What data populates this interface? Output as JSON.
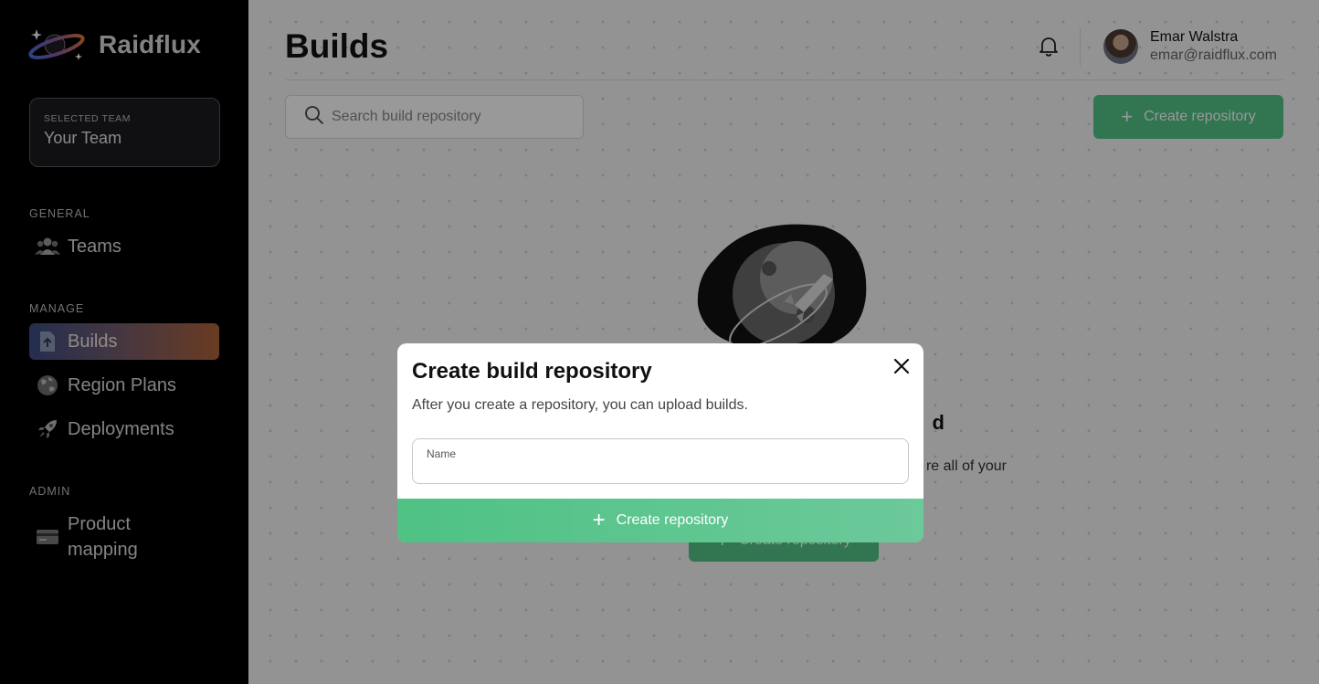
{
  "brand": {
    "name": "Raidflux"
  },
  "team": {
    "caption": "SELECTED TEAM",
    "name": "Your Team"
  },
  "sidebar": {
    "sections": [
      {
        "title": "GENERAL"
      },
      {
        "title": "MANAGE"
      },
      {
        "title": "ADMIN"
      }
    ],
    "items": [
      {
        "label": "Teams",
        "icon": "users-icon"
      },
      {
        "label": "Builds",
        "icon": "upload-file-icon",
        "active": true
      },
      {
        "label": "Region Plans",
        "icon": "globe-icon"
      },
      {
        "label": "Deployments",
        "icon": "rocket-icon"
      },
      {
        "label": "Product mapping",
        "icon": "credit-card-icon"
      }
    ]
  },
  "header": {
    "title": "Builds",
    "user": {
      "name": "Emar Walstra",
      "email": "emar@raidflux.com"
    }
  },
  "toolbar": {
    "search_placeholder": "Search build repository",
    "create_label": "Create repository"
  },
  "empty_state": {
    "title_partial": "d",
    "text_partial": "re all of your",
    "button_label": "Create repository"
  },
  "modal": {
    "title": "Create build repository",
    "description": "After you create a repository, you can upload builds.",
    "name_label": "Name",
    "name_value": "",
    "submit_label": "Create repository"
  },
  "colors": {
    "accent_green": "#52c387",
    "sidebar_bg": "#000000"
  }
}
